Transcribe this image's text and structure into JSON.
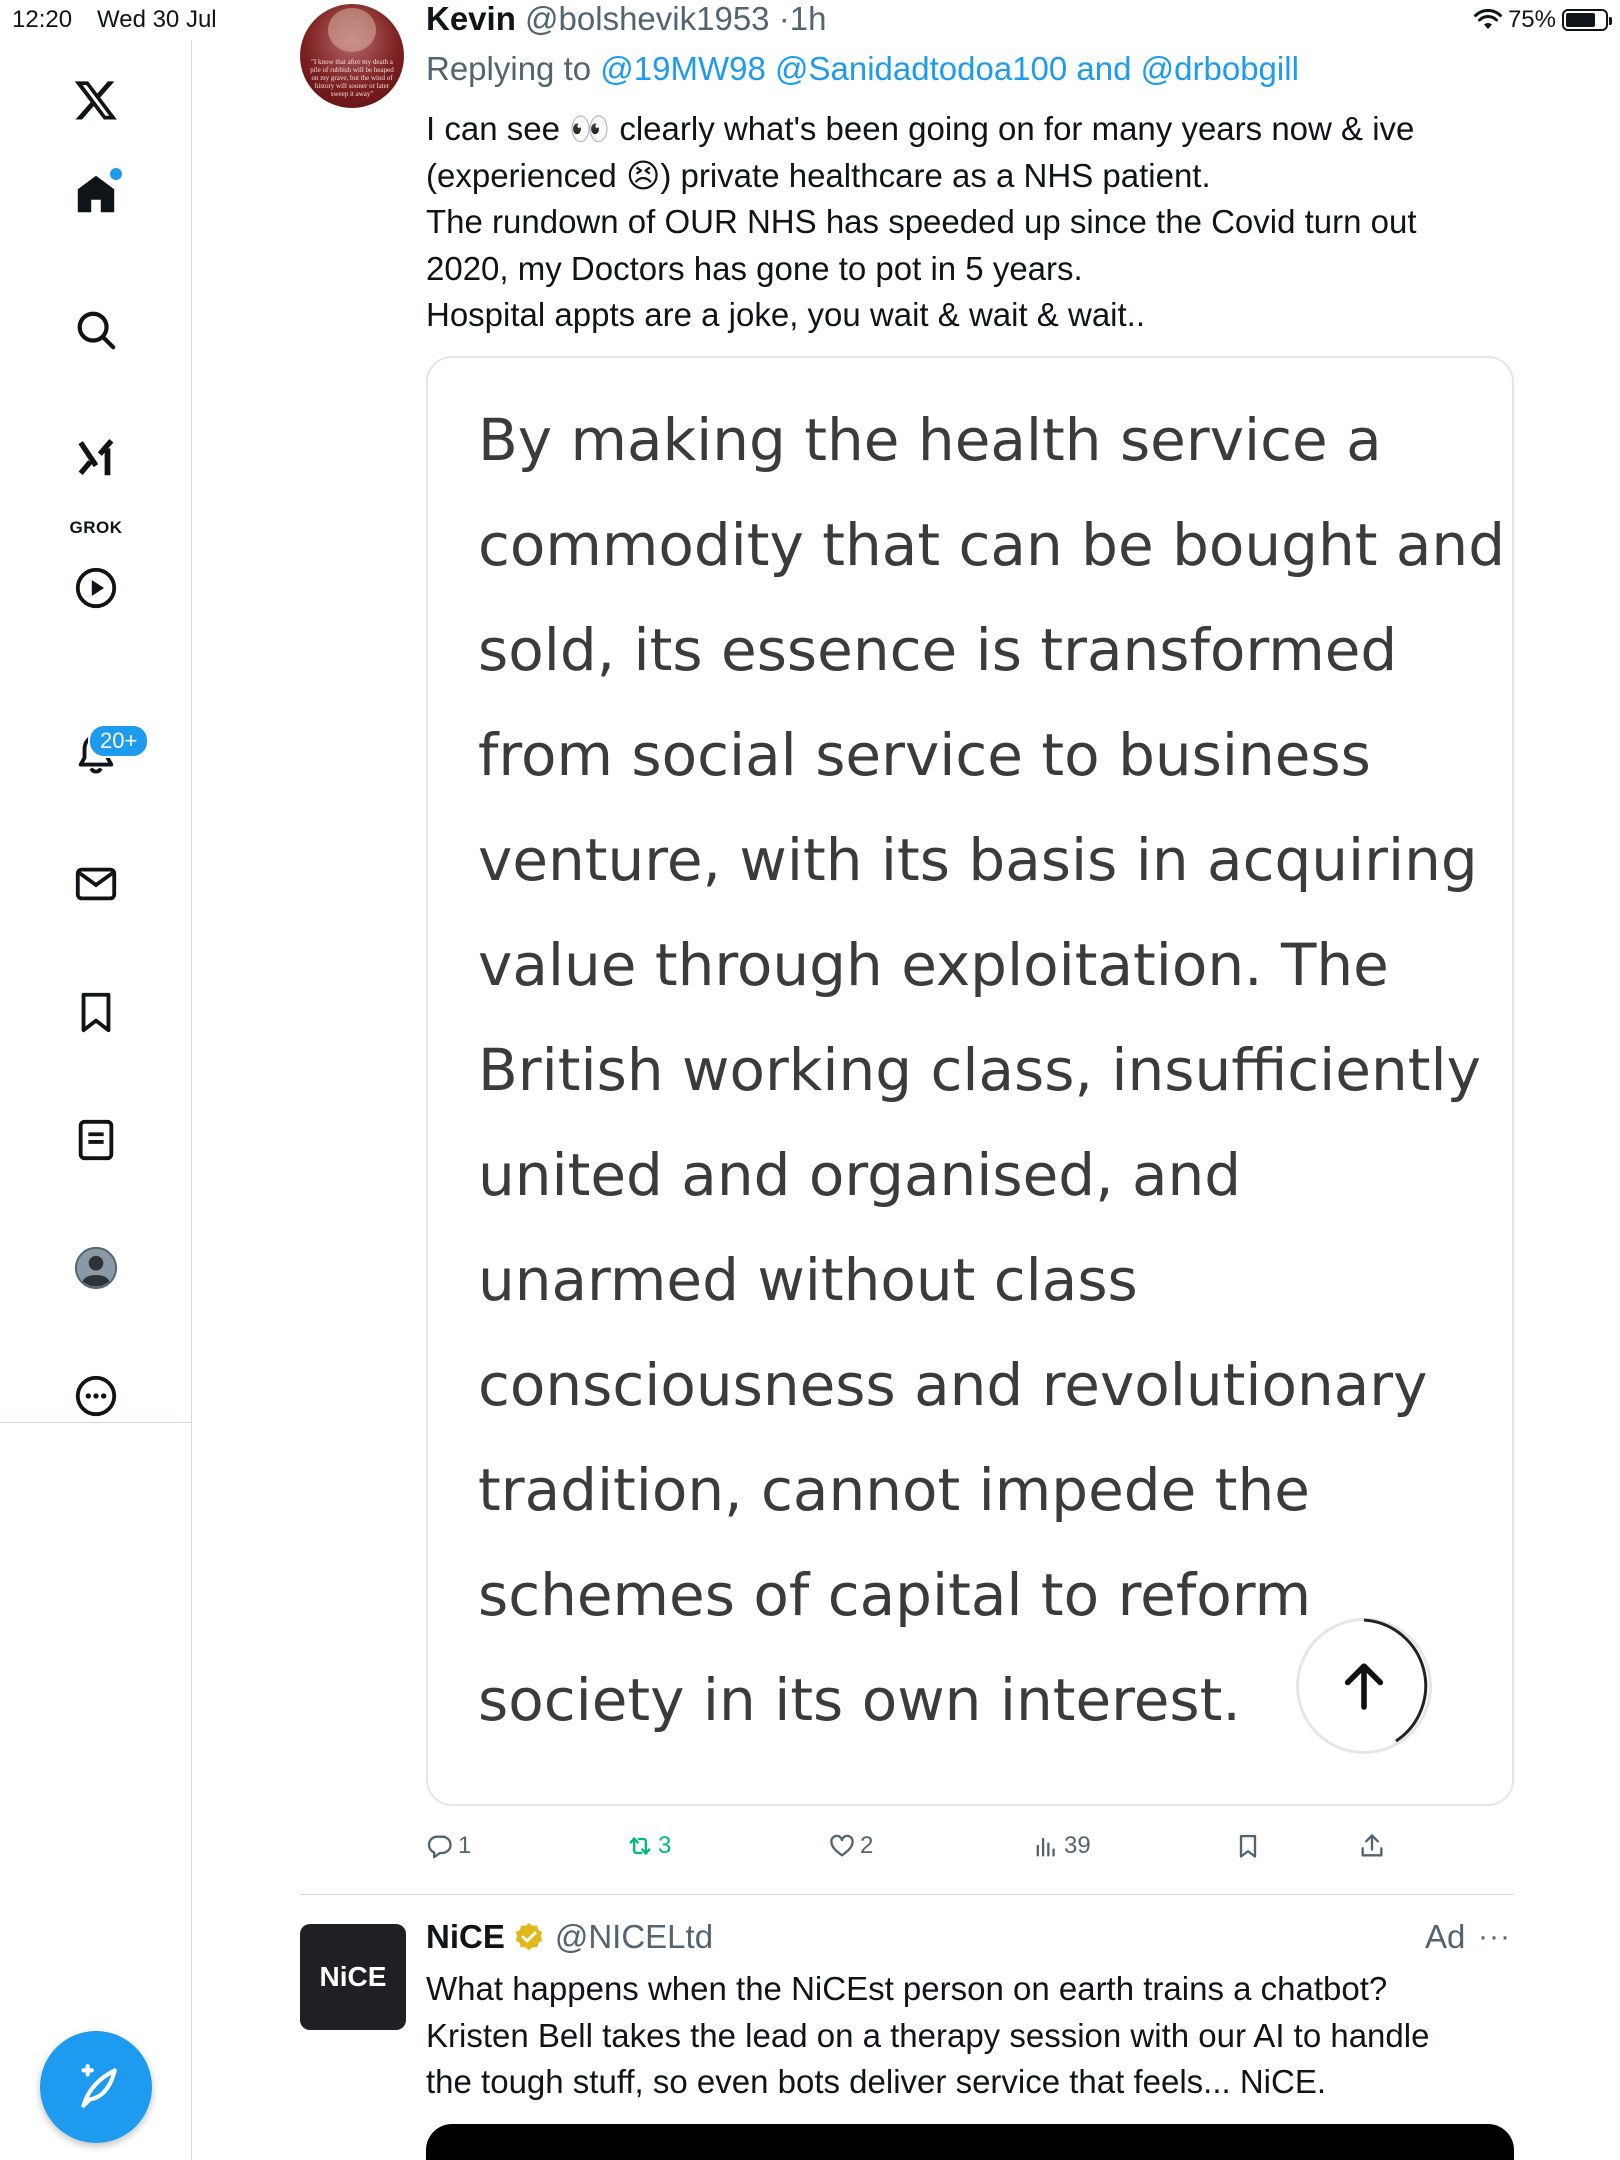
{
  "status_bar": {
    "time": "12:20",
    "date": "Wed 30 Jul",
    "battery": "75%",
    "battery_level": 0.75
  },
  "sidebar": {
    "home_has_dot": true,
    "grok_label": "GROK",
    "notifications_badge": "20+"
  },
  "tweet": {
    "author_name": "Kevin",
    "author_handle": "@bolshevik1953",
    "separator": "·",
    "time": "1h",
    "avatar_quote": "\"I know that after my death a pile of rubbish will be heaped on my grave, but the wind of history will sooner or later sweep it away\"",
    "reply_prefix": "Replying to",
    "reply_mentions": "@19MW98 @Sanidadtodoa100",
    "reply_and": "and",
    "reply_last": "@drbobgill",
    "text_lines": [
      "I can see 👀 clearly what's been going on for many years now & ive",
      "(experienced 😣) private healthcare as a NHS patient.",
      "The rundown of OUR NHS has speeded up since the Covid turn out",
      "2020, my Doctors has gone to pot in 5 years.",
      "Hospital appts are a joke, you wait & wait & wait.."
    ],
    "media_text_lines": [
      "By making the health service a",
      "commodity that can be bought and",
      "sold, its essence is transformed",
      "from social service to business",
      "venture, with its basis in acquiring",
      "value through exploitation. The",
      "British working class, insufficiently",
      "united and organised, and",
      "unarmed without class",
      "consciousness and revolutionary",
      "tradition, cannot impede the",
      "schemes of capital to reform",
      "society in its own interest."
    ],
    "actions": {
      "replies": "1",
      "reposts": "3",
      "likes": "2",
      "views": "39"
    },
    "colors": {
      "repost_active": "#00ba7c",
      "link": "#1d9bf0"
    }
  },
  "ad": {
    "avatar_text": "NiCE",
    "author_name": "NiCE",
    "author_handle": "@NICELtd",
    "ad_label": "Ad",
    "more": "···",
    "text_lines": [
      "What happens when the NiCEst person on earth trains a chatbot?",
      "Kristen Bell takes the lead on a therapy session with our AI to handle",
      "the tough stuff, so even bots deliver service that feels... NiCE."
    ]
  },
  "icons": [
    "x-logo-icon",
    "home-icon",
    "search-icon",
    "grok-icon",
    "video-icon",
    "bell-icon",
    "mail-icon",
    "bookmark-icon",
    "list-icon",
    "profile-icon",
    "more-icon",
    "compose-icon",
    "reply-icon",
    "repost-icon",
    "like-icon",
    "views-icon",
    "share-icon",
    "verified-icon",
    "scroll-up-icon"
  ]
}
